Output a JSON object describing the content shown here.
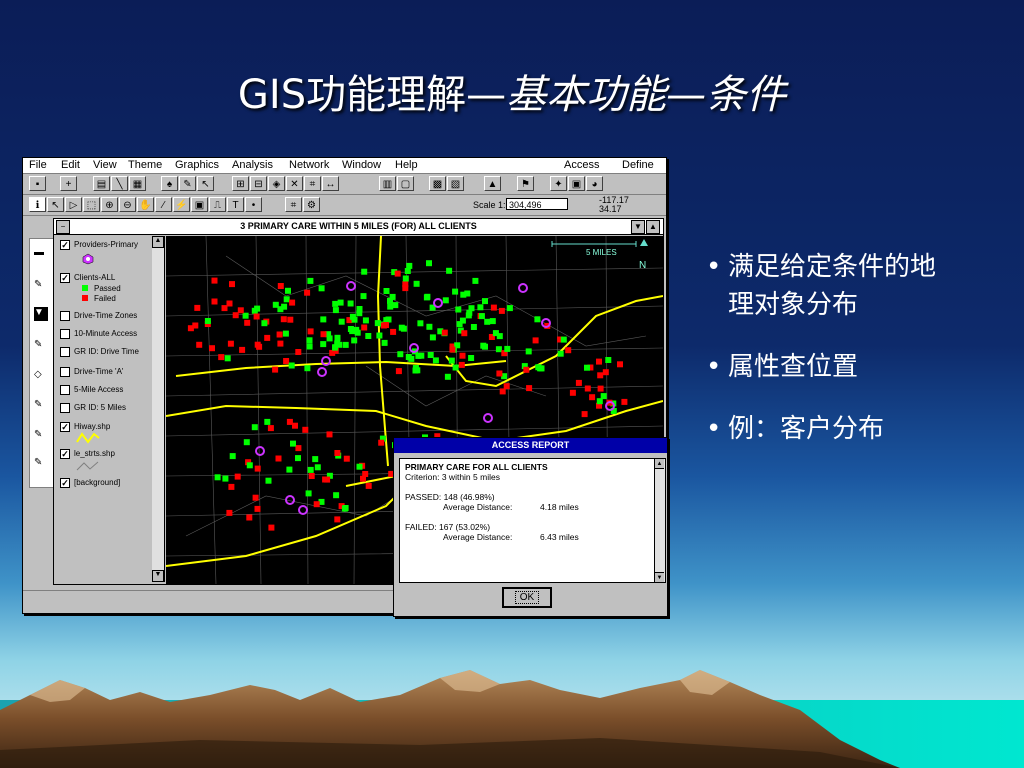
{
  "slide": {
    "title_plain": "GIS功能理解—",
    "title_italic": "基本功能—条件",
    "bullets": [
      "满足给定条件的地理对象分布",
      "属性查位置",
      "例：客户分布"
    ]
  },
  "app": {
    "menu": [
      "File",
      "Edit",
      "View",
      "Theme",
      "Graphics",
      "Analysis",
      "Network",
      "Window",
      "Help",
      "Access",
      "Define"
    ],
    "scale_label": "Scale 1:",
    "scale_value": "304,496",
    "coord_x": "-117.17",
    "coord_y": "34.17",
    "view_title": "3 PRIMARY CARE WITHIN 5 MILES  (FOR)  ALL CLIENTS",
    "scalebar_label": "5 MILES",
    "north_label": "N",
    "toc": [
      {
        "label": "Providers-Primary",
        "checked": true
      },
      {
        "label": "Clients-ALL",
        "checked": true
      },
      {
        "label": "Passed",
        "legend": true
      },
      {
        "label": "Failed",
        "legend": true
      },
      {
        "label": "Drive-Time Zones",
        "checked": false
      },
      {
        "label": "10-Minute Access",
        "checked": false
      },
      {
        "label": "GR ID: Drive Time",
        "checked": false
      },
      {
        "label": "Drive-Time 'A'",
        "checked": false
      },
      {
        "label": "5-Mile Access",
        "checked": false
      },
      {
        "label": "GR ID: 5 Miles",
        "checked": false
      },
      {
        "label": "Hiway.shp",
        "checked": true
      },
      {
        "label": "le_strts.shp",
        "checked": true
      },
      {
        "label": "[background]",
        "checked": true
      }
    ]
  },
  "dialog": {
    "title": "ACCESS REPORT",
    "line1": "PRIMARY CARE FOR ALL CLIENTS",
    "line2": "Criterion: 3 within 5 miles",
    "passed": "PASSED: 148  (46.98%)",
    "passed_avg_label": "Average Distance:",
    "passed_avg_value": "4.18 miles",
    "failed": "FAILED: 167  (53.02%)",
    "failed_avg_label": "Average Distance:",
    "failed_avg_value": "6.43 miles",
    "ok": "OK"
  },
  "colors": {
    "passed": "#00ff00",
    "failed": "#ff0000",
    "provider": "#cc33ff",
    "highway": "#ffff00"
  }
}
